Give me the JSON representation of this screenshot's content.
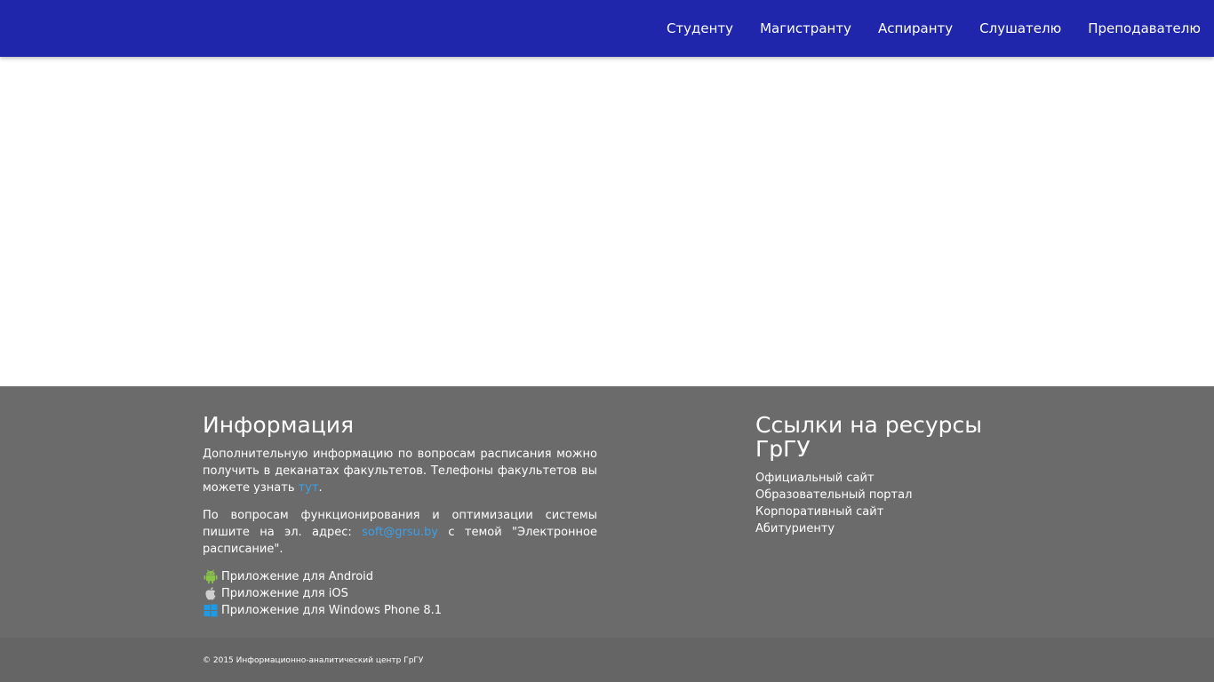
{
  "nav": {
    "items": [
      "Студенту",
      "Магистранту",
      "Аспиранту",
      "Слушателю",
      "Преподавателю"
    ]
  },
  "info": {
    "title": "Информация",
    "p1_text": "Дополнительную информацию по вопросам расписания можно получить в деканатах факультетов. Телефоны факультетов вы можете узнать ",
    "p1_link": "тут",
    "p1_end": ".",
    "p2_text": "По вопросам функционирования и оптимизации системы пишите на эл. адрес: ",
    "p2_email": "soft@grsu.by",
    "p2_end": " с темой \"Электронное расписание\".",
    "apps": [
      {
        "icon": "android-icon",
        "label": "Приложение для Android"
      },
      {
        "icon": "apple-icon",
        "label": "Приложение для iOS"
      },
      {
        "icon": "windows-icon",
        "label": "Приложение для Windows Phone 8.1"
      }
    ]
  },
  "resources": {
    "title": "Ссылки на ресурсы ГрГУ",
    "links": [
      "Официальный сайт",
      "Образовательный портал",
      "Корпоративный сайт",
      "Абитуриенту"
    ]
  },
  "footer": {
    "copyright": "© 2015 Информационно-аналитический центр ГрГУ"
  },
  "colors": {
    "navbar": "#1f26ab",
    "footer": "#6b6b6b",
    "link": "#3ba0e8",
    "android": "#8bc34a",
    "windows": "#1e9be6"
  }
}
